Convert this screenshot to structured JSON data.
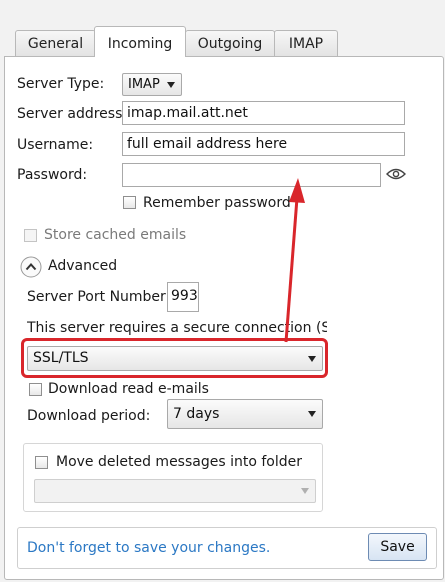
{
  "tabs": [
    {
      "label": "General"
    },
    {
      "label": "Incoming"
    },
    {
      "label": "Outgoing"
    },
    {
      "label": "IMAP"
    }
  ],
  "server_type": {
    "label": "Server Type:",
    "value": "IMAP"
  },
  "server_address": {
    "label": "Server address:",
    "value": "imap.mail.att.net"
  },
  "username": {
    "label": "Username:",
    "value": "full email address here"
  },
  "password": {
    "label": "Password:",
    "value": ""
  },
  "remember_password": {
    "label": "Remember password",
    "checked": false
  },
  "store_cached": {
    "label": "Store cached emails",
    "checked": false
  },
  "advanced": {
    "label": "Advanced"
  },
  "port": {
    "label": "Server Port Number:",
    "value": "993"
  },
  "ssl": {
    "label": "This server requires a secure connection (SSL)",
    "value": "SSL/TLS"
  },
  "download_read": {
    "label": "Download read e-mails",
    "checked": false
  },
  "download_period": {
    "label": "Download period:",
    "value": "7 days"
  },
  "move_deleted": {
    "label": "Move deleted messages into folder",
    "checked": false,
    "folder": ""
  },
  "footer": {
    "message": "Don't forget to save your changes.",
    "save_label": "Save"
  },
  "colors": {
    "highlight": "#d9262b",
    "arrow": "#d9262b",
    "hint_text": "#2b78c4"
  }
}
